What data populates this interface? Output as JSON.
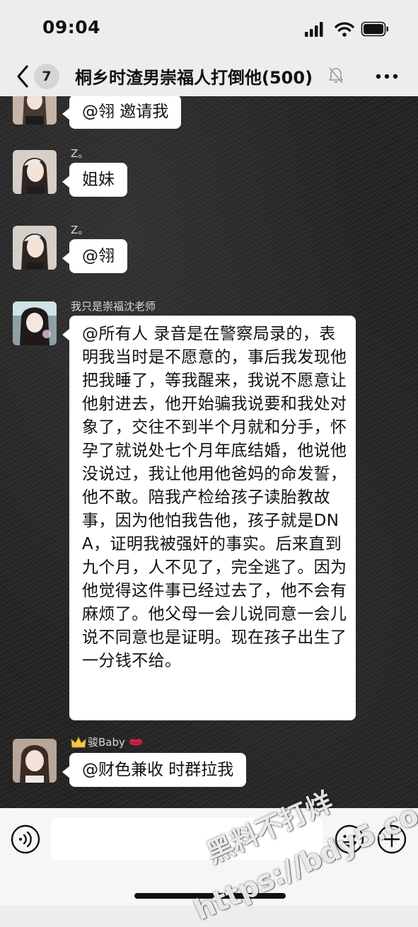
{
  "status_bar": {
    "time": "09:04",
    "icons": [
      "signal-icon",
      "wifi-icon",
      "battery-icon"
    ]
  },
  "header": {
    "unread_count": "7",
    "title": "桐乡时渣男崇福人打倒他(500)",
    "muted": true,
    "icons": [
      "back-icon",
      "mute-icon",
      "more-icon"
    ]
  },
  "messages": [
    {
      "sender": "",
      "text": "@翎 邀请我"
    },
    {
      "sender": "Z。",
      "text": "姐妹"
    },
    {
      "sender": "Z。",
      "text": "@翎"
    },
    {
      "sender": "我只是崇福沈老师",
      "text": "@所有人 录音是在警察局录的，表明我当时是不愿意的，事后我发现他把我睡了，等我醒来，我说不愿意让他射进去，他开始骗我说要和我处对象了，交往不到半个月就和分手，怀孕了就说处七个月年底结婚，他说他没说过，我让他用他爸妈的命发誓，他不敢。陪我产检给孩子读胎教故事，因为他怕我告他，孩子就是DNA，证明我被强奸的事实。后来直到九个月，人不见了，完全逃了。因为他觉得这件事已经过去了，他不会有麻烦了。他父母一会儿说同意一会儿说不同意也是证明。现在孩子出生了一分钱不给。"
    },
    {
      "sender": "骏Baby",
      "sender_prefix_icon": "crown-icon",
      "sender_suffix_icon": "lips-icon",
      "text": "@财色兼收 时群拉我"
    }
  ],
  "input_bar": {
    "icons": [
      "voice-icon",
      "emoji-icon",
      "plus-icon"
    ]
  },
  "watermark": {
    "line1": "黑料不打烊",
    "line2": "https://bdy5.co"
  },
  "colors": {
    "chat_background": "#232323",
    "bubble": "#ffffff",
    "header_background": "#ededed",
    "sender_text": "#d8d8d8"
  }
}
